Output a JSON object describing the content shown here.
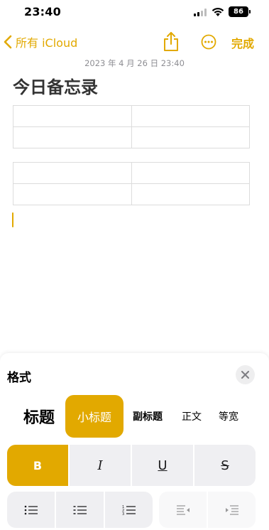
{
  "status_bar": {
    "time": "23:40",
    "battery": "86"
  },
  "nav": {
    "back_label": "所有 iCloud",
    "share_icon": "share-icon",
    "more_icon": "ellipsis-circle-icon",
    "done_label": "完成"
  },
  "note": {
    "date": "2023 年 4 月 26 日 23:40",
    "title": "今日备忘录",
    "tables": [
      {
        "rows": [
          [
            "",
            ""
          ],
          [
            "",
            ""
          ]
        ]
      },
      {
        "rows": [
          [
            "",
            ""
          ],
          [
            "",
            ""
          ]
        ]
      }
    ]
  },
  "format_sheet": {
    "title": "格式",
    "close_icon": "close-icon",
    "styles": [
      {
        "label": "标题",
        "selected": false
      },
      {
        "label": "小标题",
        "selected": true
      },
      {
        "label": "副标题",
        "selected": false
      },
      {
        "label": "正文",
        "selected": false
      },
      {
        "label": "等宽",
        "selected": false
      }
    ],
    "text_styles": [
      {
        "label": "B",
        "name": "bold",
        "active": true
      },
      {
        "label": "I",
        "name": "italic",
        "active": false
      },
      {
        "label": "U",
        "name": "underline",
        "active": false
      },
      {
        "label": "S",
        "name": "strikethrough",
        "active": false
      }
    ],
    "list_icons": [
      "bulleted-list-icon",
      "dashed-list-icon",
      "numbered-list-icon"
    ],
    "indent_icons": [
      "outdent-icon",
      "indent-icon"
    ]
  },
  "colors": {
    "accent": "#e2a900",
    "button_bg": "#efeff2",
    "secondary_text": "#8e8e93"
  }
}
